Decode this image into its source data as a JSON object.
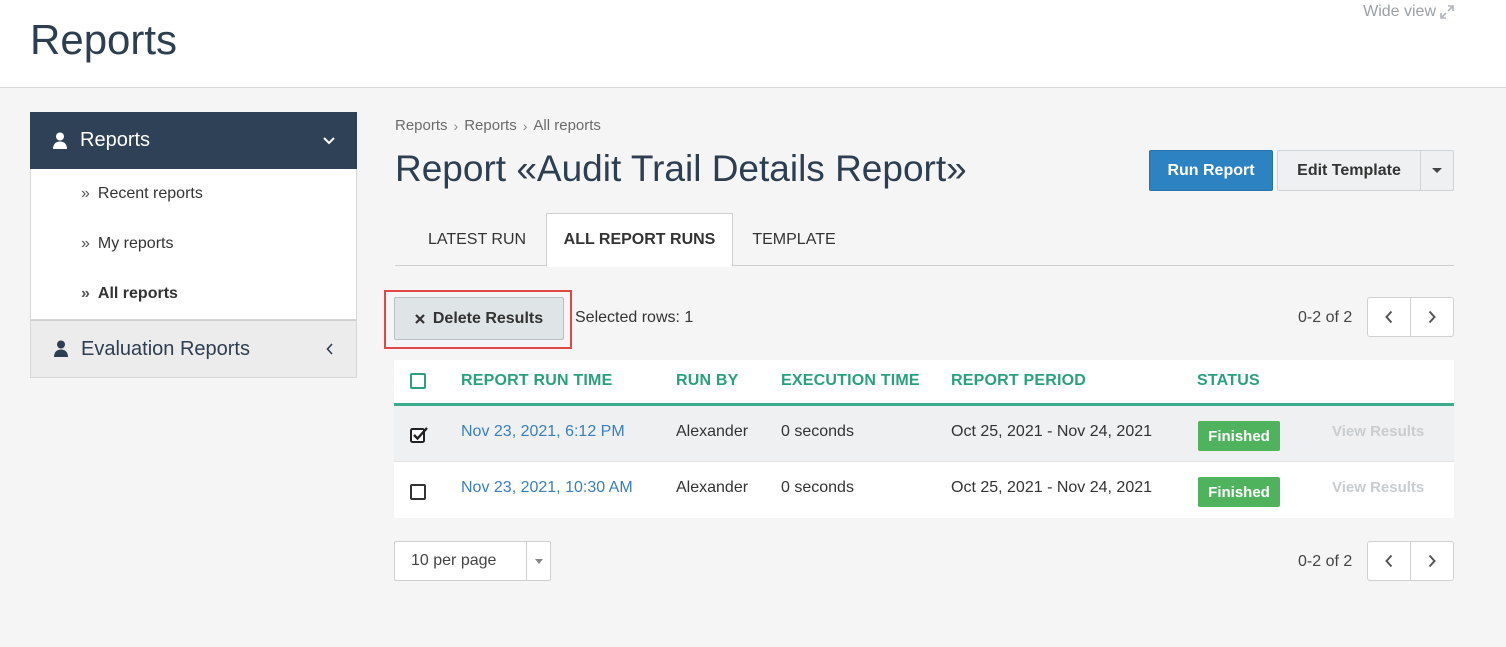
{
  "header": {
    "title": "Reports",
    "wide_view": "Wide view"
  },
  "sidebar": {
    "section1": "Reports",
    "items": [
      {
        "label": "Recent reports"
      },
      {
        "label": "My reports"
      },
      {
        "label": "All reports"
      }
    ],
    "section2": "Evaluation Reports"
  },
  "breadcrumb": [
    "Reports",
    "Reports",
    "All reports"
  ],
  "main": {
    "title": "Report «Audit Trail Details Report»",
    "run_report": "Run Report",
    "edit_template": "Edit Template",
    "tabs": [
      {
        "label": "LATEST RUN"
      },
      {
        "label": "ALL REPORT RUNS"
      },
      {
        "label": "TEMPLATE"
      }
    ],
    "delete_results": "Delete Results",
    "selected_rows": "Selected rows: 1",
    "pager_info": "0-2 of 2",
    "per_page": "10 per page"
  },
  "table": {
    "headers": [
      "REPORT RUN TIME",
      "RUN BY",
      "EXECUTION TIME",
      "REPORT PERIOD",
      "STATUS"
    ],
    "rows": [
      {
        "run_time": "Nov 23, 2021, 6:12 PM",
        "run_by": "Alexander",
        "execution_time": "0 seconds",
        "period": "Oct 25, 2021 - Nov 24, 2021",
        "status": "Finished",
        "action": "View Results",
        "checked": true
      },
      {
        "run_time": "Nov 23, 2021, 10:30 AM",
        "run_by": "Alexander",
        "execution_time": "0 seconds",
        "period": "Oct 25, 2021 - Nov 24, 2021",
        "status": "Finished",
        "action": "View Results",
        "checked": false
      }
    ]
  },
  "colors": {
    "accent": "#2d82c1",
    "table_header": "#2ba07f",
    "status_finished": "#4fb35e",
    "sidebar_active": "#2f4156",
    "highlight": "#e04848"
  }
}
